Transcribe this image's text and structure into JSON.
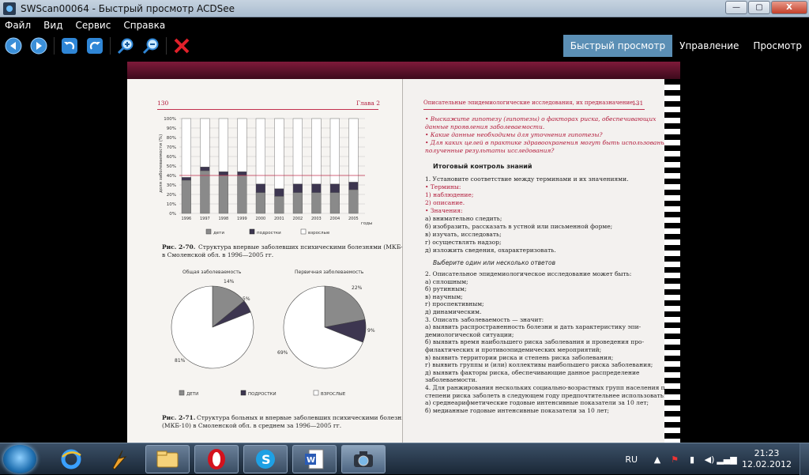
{
  "window": {
    "title": "SWScan00064 - Быстрый просмотр ACDSee",
    "minimize": "—",
    "maximize": "▢",
    "close": "X"
  },
  "menu": [
    "Файл",
    "Вид",
    "Сервис",
    "Справка"
  ],
  "toolbar": {
    "icons": [
      "back-icon",
      "forward-icon",
      "rotate-left-icon",
      "rotate-right-icon",
      "zoom-in-icon",
      "zoom-out-icon",
      "delete-icon"
    ]
  },
  "modes": {
    "quick_view": "Быстрый просмотр",
    "manage": "Управление",
    "view": "Просмотр"
  },
  "scan": {
    "left": {
      "page_num": "130",
      "chapter": "Глава 2",
      "y_ticks": [
        "100%",
        "90%",
        "80%",
        "70%",
        "60%",
        "50%",
        "40%",
        "30%",
        "20%",
        "10%",
        "0%"
      ],
      "y_label": "доля заболеваемости (%)",
      "years": [
        "1996",
        "1997",
        "1998",
        "1999",
        "2000",
        "2001",
        "2002",
        "2003",
        "2004",
        "2005"
      ],
      "year_unit": "годы",
      "legend": [
        "дети",
        "подростки",
        "взрослые"
      ],
      "caption1_bold": "Рис. 2-70.",
      "caption1_a": "Структура впервые заболевших психическими болезнями (МКБ-10)",
      "caption1_b": "в Смоленской обл. в 1996—2005 гг.",
      "pie1_title": "Общая заболеваемость",
      "pie1_labels": [
        "14%",
        "5%",
        "81%"
      ],
      "pie2_title": "Первичная заболеваемость",
      "pie2_labels": [
        "22%",
        "9%",
        "69%"
      ],
      "pie_legend": [
        "ДЕТИ",
        "ПОДРОСТКИ",
        "ВЗРОСЛЫЕ"
      ],
      "caption2_bold": "Рис. 2-71.",
      "caption2_a": "Структура больных и впервые заболевших психическими болезнями",
      "caption2_b": "(МКБ-10) в Смоленской обл. в среднем за 1996—2005 гг."
    },
    "right": {
      "header": "Описательные эпидемиологические исследования, их предназначение...",
      "page_num": "131",
      "lines": [
        "•  Выскажите гипотезу (гипотезы) о факторах риска, обеспечивающих",
        "   данные проявления заболеваемости.",
        "•  Какие данные необходимы для уточнения гипотезы?",
        "•  Для каких целей в практике здравоохранения могут быть использованы",
        "   полученные результаты исследования?"
      ],
      "heading1": "Итоговый контроль знаний",
      "body": [
        "1.  Установите соответствие между терминами и их значениями.",
        "•  Термины:",
        "   1)  наблюдение;",
        "   2)  описание.",
        "•  Значения:",
        "   а)  внимательно следить;",
        "   б)  изобразить, рассказать в устной или письменной форме;",
        "   в)  изучать, исследовать;",
        "   г)  осуществлять надзор;",
        "   д)  изложить сведения, охарактеризовать."
      ],
      "heading2": "Выберите один или несколько ответов",
      "body2": [
        "2.  Описательное эпидемиологическое исследование может быть:",
        "   а)  сплошным;",
        "   б)  рутинным;",
        "   в)  научным;",
        "   г)  проспективным;",
        "   д)  динамическим.",
        "3.  Описать заболеваемость — значит:",
        "   а)  выявить распространенность болезни и дать характеристику эпи-",
        "        демиологической ситуации;",
        "   б)  выявить время наибольшего риска заболевания и проведения про-",
        "        филактических и противоэпидемических мероприятий;",
        "   в)  выявить территории риска и степень риска заболевания;",
        "   г)  выявить группы и (или) коллективы наибольшего риска заболевания;",
        "   д)  выявить факторы риска, обеспечивающие данное распределение",
        "        заболеваемости.",
        "4.  Для ранжирования нескольких социально-возрастных групп населения по",
        "     степени риска заболеть в следующем году предпочтительнее использовать:",
        "   а)  среднеарифметические годовые интенсивные показатели за 10 лет;",
        "   б)  медианные годовые интенсивные показатели за 10 лет;"
      ]
    }
  },
  "taskbar": {
    "apps": [
      "start-button",
      "ie-icon",
      "winamp-icon",
      "explorer-icon",
      "opera-icon",
      "skype-icon",
      "word-icon",
      "acdsee-icon"
    ],
    "lang": "RU",
    "time": "21:23",
    "date": "12.02.2012"
  }
}
